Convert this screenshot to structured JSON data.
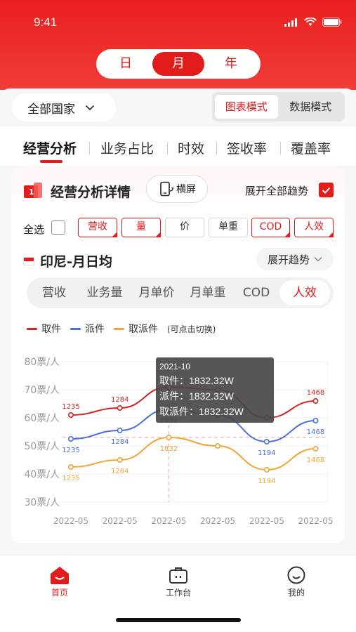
{
  "status_bar": {
    "time": "9:41"
  },
  "period_toggle": {
    "items": [
      "日",
      "月",
      "年"
    ],
    "active_index": 1
  },
  "country_select": {
    "value": "全部国家"
  },
  "view_mode": {
    "items": [
      "图表模式",
      "数据模式"
    ],
    "active_index": 0
  },
  "main_tabs": {
    "items": [
      "经营分析",
      "业务占比",
      "时效",
      "签收率",
      "覆盖率"
    ],
    "active_index": 0
  },
  "card": {
    "icon_badge": "1",
    "title": "经营分析详情",
    "landscape_label": "横屏",
    "expand_all_label": "展开全部趋势",
    "expand_all_checked": true,
    "select_all_label": "全选",
    "select_all_checked": false,
    "filter_chips": [
      {
        "label": "营收",
        "selected": true
      },
      {
        "label": "量",
        "selected": true
      },
      {
        "label": "价",
        "selected": false
      },
      {
        "label": "单重",
        "selected": false
      },
      {
        "label": "COD",
        "selected": true
      },
      {
        "label": "人效",
        "selected": true
      }
    ]
  },
  "region": {
    "title": "印尼-月日均",
    "expand_label": "展开趋势"
  },
  "metric_tabs": {
    "items": [
      "营收",
      "业务量",
      "月单价",
      "月单重",
      "COD",
      "人效"
    ],
    "active_index": 5
  },
  "legend": {
    "note": "(可点击切换)"
  },
  "chart_data": {
    "type": "line",
    "x": [
      "2022-05",
      "2022-05",
      "2022-05",
      "2022-05",
      "2022-05",
      "2022-05"
    ],
    "yticks": [
      "30票/人",
      "40票/人",
      "50票/人",
      "60票/人",
      "70票/人",
      "80票/人"
    ],
    "ylim": [
      30,
      80
    ],
    "reference_line": 53,
    "series": [
      {
        "name": "取件",
        "color": "#d91f1f",
        "values": [
          61,
          63.5,
          71,
          70,
          60,
          66
        ],
        "labels": [
          "1235",
          "1284",
          "1832",
          "",
          "",
          "1468"
        ]
      },
      {
        "name": "派件",
        "color": "#4a6fe3",
        "values": [
          52.5,
          55.5,
          63,
          61,
          51.5,
          59
        ],
        "labels": [
          "1235",
          "1284",
          "1832",
          "",
          "1194",
          "1468"
        ]
      },
      {
        "name": "取派件",
        "color": "#f0a535",
        "values": [
          42.5,
          45,
          53,
          50,
          41.5,
          49
        ],
        "labels": [
          "1235",
          "1284",
          "1832",
          "",
          "1194",
          "1468"
        ]
      }
    ],
    "highlight_index": 2,
    "tooltip": {
      "date": "2021-10",
      "rows": [
        {
          "label": "取件：",
          "value": "1832.32W"
        },
        {
          "label": "派件：",
          "value": "1832.32W"
        },
        {
          "label": "取派件：",
          "value": "1832.32W"
        }
      ]
    }
  },
  "bottom_nav": {
    "items": [
      "首页",
      "工作台",
      "我的"
    ],
    "active_index": 0
  }
}
